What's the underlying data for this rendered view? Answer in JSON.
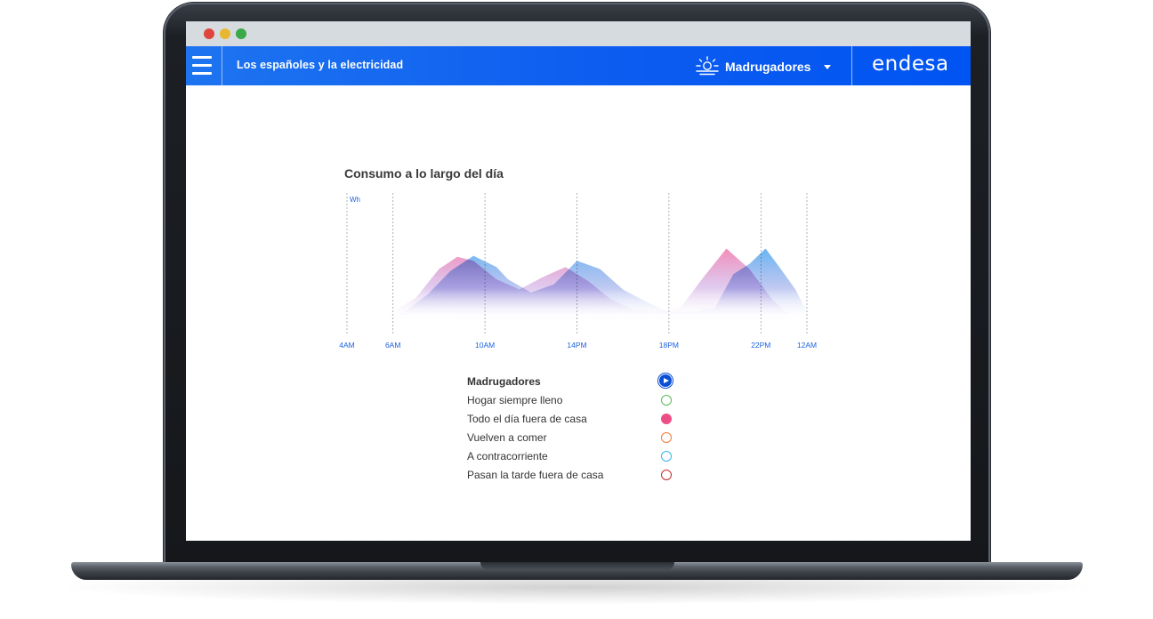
{
  "app": {
    "title": "Los españoles y la electricidad",
    "profile_selected": "Madrugadores",
    "brand": "endesa",
    "accent": "#0a5cf0"
  },
  "chart_data": {
    "type": "area",
    "title": "Consumo a lo largo del día",
    "ylabel": "Wh",
    "x_ticks": [
      "4AM",
      "6AM",
      "10AM",
      "14PM",
      "18PM",
      "22PM",
      "12AM"
    ],
    "x_hours": [
      4,
      6,
      10,
      14,
      18,
      22,
      24
    ],
    "xlim": [
      4,
      24
    ],
    "ylim": [
      0,
      100
    ],
    "grid": "vertical dashed",
    "series": [
      {
        "color": "#f07fb0",
        "x": [
          5,
          6,
          7,
          8,
          8.8,
          9.5,
          10.5,
          11.5,
          12.5,
          13.5,
          14.5,
          15.5,
          16.5,
          17.5,
          18.5,
          19.5,
          20.5,
          21.5,
          22.5,
          23.5
        ],
        "y": [
          0,
          8,
          22,
          50,
          62,
          58,
          40,
          30,
          42,
          52,
          38,
          20,
          10,
          8,
          12,
          42,
          70,
          50,
          20,
          0
        ]
      },
      {
        "color": "#5fb2f2",
        "x": [
          5.5,
          6.5,
          7.5,
          8.5,
          9.5,
          10.5,
          11,
          12,
          13,
          14,
          15,
          16,
          17,
          18,
          19,
          20,
          20.8,
          21.5,
          22.2,
          22.8,
          23.5,
          24
        ],
        "y": [
          0,
          8,
          25,
          48,
          63,
          52,
          40,
          27,
          35,
          58,
          50,
          30,
          18,
          8,
          8,
          12,
          45,
          55,
          70,
          52,
          30,
          8
        ]
      }
    ]
  },
  "legend": [
    {
      "label": "Madrugadores",
      "color": "#0a4fd6",
      "marker": "play",
      "active": true
    },
    {
      "label": "Hogar siempre lleno",
      "color": "#5cb85c",
      "marker": "ring",
      "active": false
    },
    {
      "label": "Todo el día fuera de casa",
      "color": "#ee4e86",
      "marker": "filled",
      "active": false
    },
    {
      "label": "Vuelven a comer",
      "color": "#f07a3e",
      "marker": "ring",
      "active": false
    },
    {
      "label": "A contracorriente",
      "color": "#37b5e6",
      "marker": "ring",
      "active": false
    },
    {
      "label": "Pasan la tarde fuera de casa",
      "color": "#cc2a2a",
      "marker": "ring",
      "active": false
    }
  ]
}
